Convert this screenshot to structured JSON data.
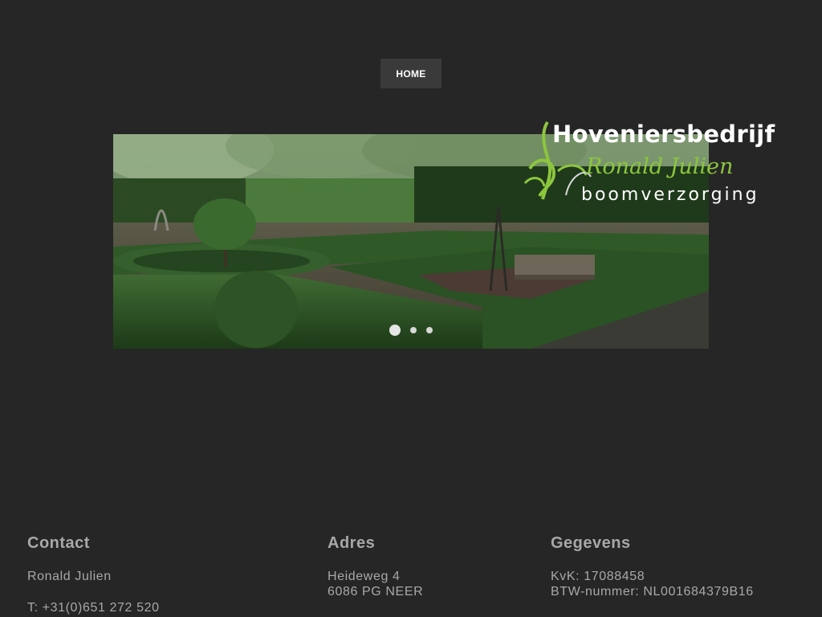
{
  "nav": {
    "items": [
      {
        "label": "HOME"
      }
    ]
  },
  "logo": {
    "line1": "Hoveniersbedrijf",
    "line2": "Ronald Julien",
    "line3": "boomverzorging"
  },
  "slider": {
    "slide_count": 3,
    "active_index": 0
  },
  "footer": {
    "contact": {
      "title": "Contact",
      "name": "Ronald Julien",
      "phone": "T: +31(0)651 272 520"
    },
    "address": {
      "title": "Adres",
      "street": "Heideweg 4",
      "city": "6086 PG NEER"
    },
    "details": {
      "title": "Gegevens",
      "kvk": "KvK: 17088458",
      "btw": "BTW-nummer: NL001684379B16"
    }
  },
  "colors": {
    "background": "#262626",
    "nav_bg": "#3a3a3a",
    "brand_green": "#8cc63f",
    "footer_text": "#a8a8a8"
  }
}
